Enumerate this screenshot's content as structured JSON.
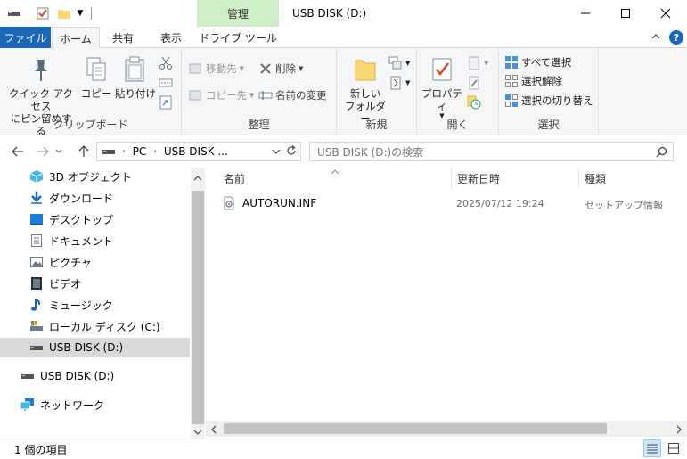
{
  "window": {
    "title": "USB DISK (D:)",
    "context_tab_label": "管理",
    "minimize": "—",
    "maximize": "☐",
    "close": "✕"
  },
  "tabs": {
    "file": "ファイル",
    "home": "ホーム",
    "share": "共有",
    "view": "表示",
    "drive_tools": "ドライブ ツール"
  },
  "ribbon": {
    "clipboard": {
      "label": "クリップボード",
      "pin_quick_access": "クイック アクセス\nにピン留めする",
      "copy": "コピー",
      "paste": "貼り付け"
    },
    "organize": {
      "label": "整理",
      "move_to": "移動先",
      "copy_to": "コピー先",
      "delete": "削除",
      "rename": "名前の変更"
    },
    "new": {
      "label": "新規",
      "new_folder": "新しい\nフォルダー"
    },
    "open": {
      "label": "開く",
      "properties": "プロパティ"
    },
    "select": {
      "label": "選択",
      "select_all": "すべて選択",
      "select_none": "選択解除",
      "invert_selection": "選択の切り替え"
    }
  },
  "address": {
    "crumbs": [
      "PC",
      "USB DISK ..."
    ],
    "search_placeholder": "USB DISK (D:)の検索"
  },
  "nav": {
    "items": [
      {
        "label": "3D オブジェクト",
        "icon": "3d-objects-icon"
      },
      {
        "label": "ダウンロード",
        "icon": "downloads-icon"
      },
      {
        "label": "デスクトップ",
        "icon": "desktop-icon"
      },
      {
        "label": "ドキュメント",
        "icon": "documents-icon"
      },
      {
        "label": "ピクチャ",
        "icon": "pictures-icon"
      },
      {
        "label": "ビデオ",
        "icon": "videos-icon"
      },
      {
        "label": "ミュージック",
        "icon": "music-icon"
      },
      {
        "label": "ローカル ディスク (C:)",
        "icon": "local-disk-icon"
      },
      {
        "label": "USB DISK (D:)",
        "icon": "usb-drive-icon",
        "selected": true
      },
      {
        "label": "USB DISK (D:)",
        "icon": "usb-drive-icon"
      },
      {
        "label": "ネットワーク",
        "icon": "network-icon"
      }
    ]
  },
  "columns": {
    "name": "名前",
    "modified": "更新日時",
    "type": "種類"
  },
  "files": [
    {
      "name": "AUTORUN.INF",
      "modified": "2025/07/12 19:24",
      "type": "セットアップ情報"
    }
  ],
  "status": {
    "item_count": "1 個の項目"
  },
  "colors": {
    "file_tab": "#1a67b8",
    "context_tab": "#cdeec6",
    "selected_nav": "#d9d9d9"
  }
}
